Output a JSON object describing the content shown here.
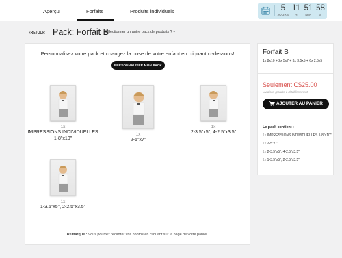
{
  "nav": {
    "tabs": [
      {
        "label": "Aperçu"
      },
      {
        "label": "Forfaits",
        "active": true
      },
      {
        "label": "Produits individuels"
      }
    ]
  },
  "countdown": {
    "days": "5",
    "days_label": "JOURS",
    "hours": "11",
    "hours_label": "H",
    "minutes": "51",
    "minutes_label": "MIN",
    "seconds": "58",
    "seconds_label": "S",
    "bg_color": "#cfe8f1"
  },
  "header": {
    "back_label": "RETOUR",
    "title": "Pack: Forfait B",
    "select_other": "Sélectionner un autre pack de produits ?"
  },
  "main": {
    "intro": "Personnalisez votre pack et changez la pose de votre enfant en cliquant ci-dessous!",
    "customize_button": "PERSONNALISER MON PACK",
    "items": [
      {
        "qty": "1x",
        "name_lines": [
          "IMPRESSIONS INDIVIDUELLES",
          "1-8\"x10\""
        ]
      },
      {
        "qty": "1x",
        "name_lines": [
          "2-5\"x7\"",
          ""
        ]
      },
      {
        "qty": "1x",
        "name_lines": [
          "2-3.5\"x5\", 4-2.5\"x3.5\"",
          ""
        ]
      },
      {
        "qty": "1x",
        "name_lines": [
          "1-3.5\"x5\", 2-2.5\"x3.5\"",
          ""
        ]
      }
    ],
    "remark_label": "Remarque :",
    "remark_text": " Vous pourrez recadrer vos photos en cliquant sur la page de votre panier."
  },
  "side": {
    "title": "Forfait B",
    "description": "1x 8x10 + 2x 5x7 + 3x 3,5x5 + 6x 2,5x5",
    "price": "Seulement C$25.00",
    "delivery": "Livraison gratuite à l'établissement",
    "add_to_cart": "AJOUTER AU PANIER",
    "contents_title": "Le pack contient :",
    "contents": [
      {
        "qty": "1x",
        "label": "IMPRESSIONS INDIVIDUELLES 1-8\"x10\""
      },
      {
        "qty": "1x",
        "label": "2-5\"x7\""
      },
      {
        "qty": "1x",
        "label": "2-3.5\"x5\", 4-2.5\"x3.5\""
      },
      {
        "qty": "1x",
        "label": "1-3.5\"x5\", 2-2.5\"x3.5\""
      }
    ],
    "price_color": "#d9534f"
  },
  "icons": {
    "calendar": "calendar-icon",
    "cart": "cart-icon",
    "chevron": "chevron-left-icon",
    "dropdown": "chevron-down-icon"
  }
}
